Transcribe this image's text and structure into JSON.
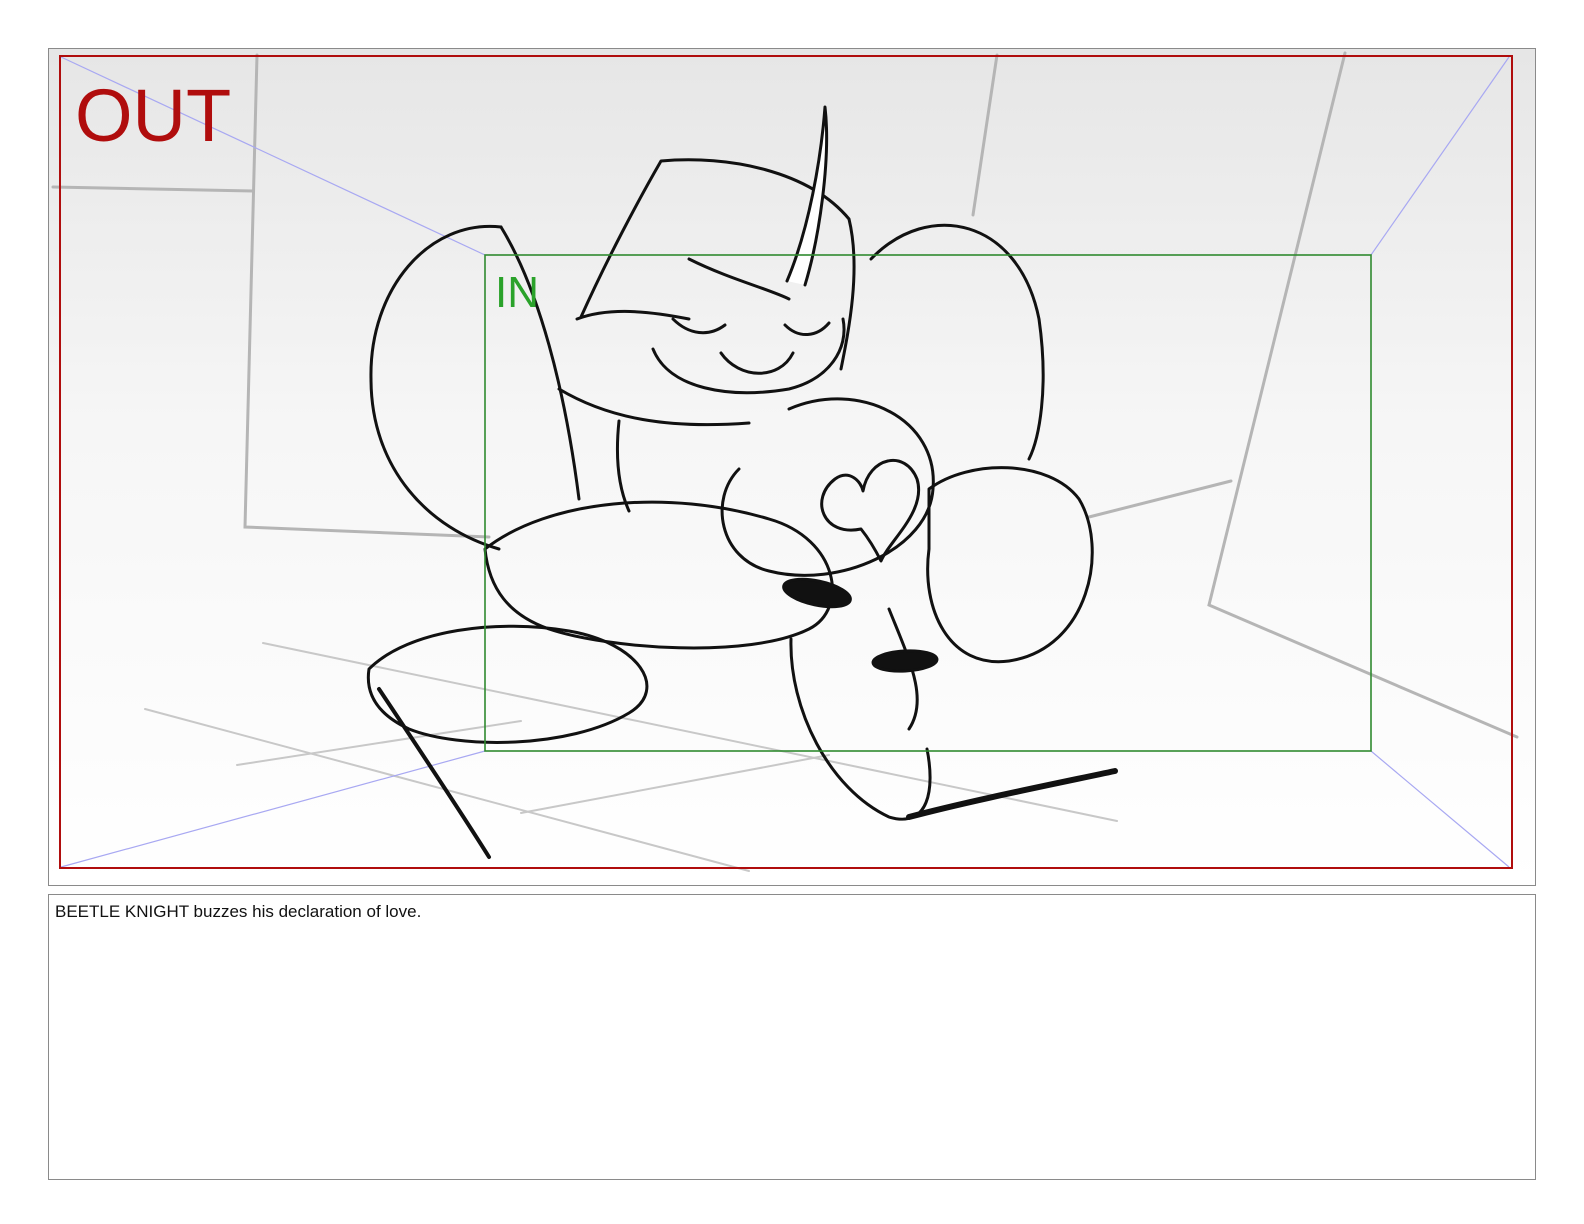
{
  "panel": {
    "out_label": "OUT",
    "in_label": "IN",
    "colors": {
      "out_frame": "#b00d0d",
      "in_frame": "#2f8a2f",
      "perspective_lines": "#9a9af0",
      "sketch_lines": "#111111",
      "background_lines": "#b9b9b9"
    },
    "sketch_subject": "beetle-knight-drawing"
  },
  "notes": {
    "text": "BEETLE KNIGHT buzzes his declaration of love."
  }
}
